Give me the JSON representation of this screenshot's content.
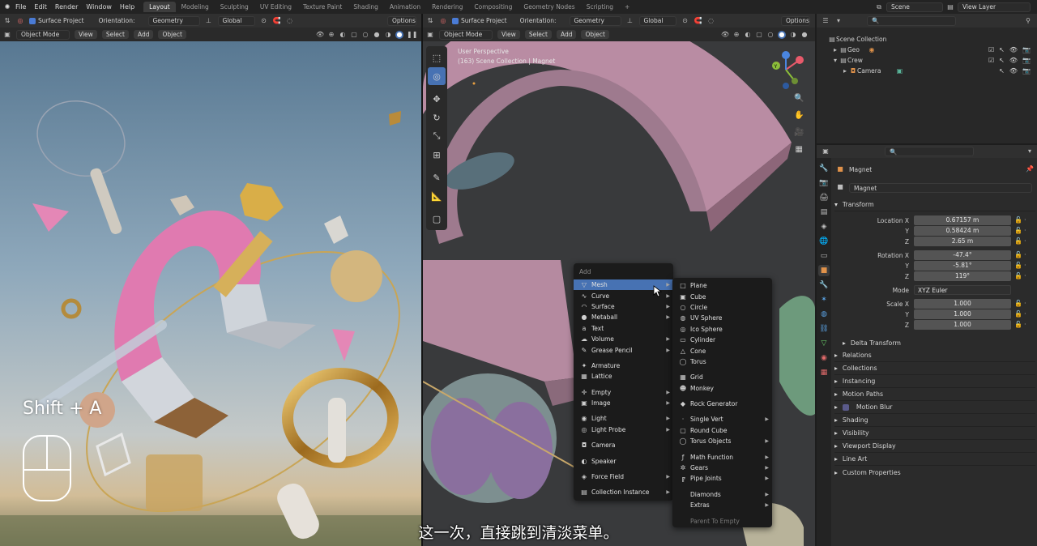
{
  "topbar": {
    "menus": [
      "File",
      "Edit",
      "Render",
      "Window",
      "Help"
    ],
    "workspaces": [
      "Layout",
      "Modeling",
      "Sculpting",
      "UV Editing",
      "Texture Paint",
      "Shading",
      "Animation",
      "Rendering",
      "Compositing",
      "Geometry Nodes",
      "Scripting"
    ],
    "active_workspace": "Layout",
    "plus": "+",
    "scene": "Scene",
    "view_layer": "View Layer"
  },
  "left_header": {
    "surface_project": "Surface Project",
    "orientation_label": "Orientation:",
    "orientation_value": "Geometry",
    "transform_space": "Global",
    "options": "Options",
    "mode": "Object Mode",
    "menus": [
      "View",
      "Select",
      "Add",
      "Object"
    ]
  },
  "right_header": {
    "surface_project": "Surface Project",
    "orientation_label": "Orientation:",
    "orientation_value": "Geometry",
    "transform_space": "Global",
    "options": "Options",
    "mode": "Object Mode",
    "menus": [
      "View",
      "Select",
      "Add",
      "Object"
    ]
  },
  "viewport_info": {
    "line1": "User Perspective",
    "line2": "(163) Scene Collection | Magnet"
  },
  "overlay": {
    "shortcut": "Shift + A"
  },
  "subtitle": "这一次，直接跳到清淡菜单。",
  "outliner": {
    "root": "Scene Collection",
    "items": [
      {
        "name": "Geo",
        "level": 1
      },
      {
        "name": "Crew",
        "level": 1
      },
      {
        "name": "Camera",
        "level": 2
      }
    ]
  },
  "properties": {
    "object_name": "Magnet",
    "data_name": "Magnet",
    "transform_title": "Transform",
    "location_label": "Location X",
    "location": [
      "0.67157 m",
      "0.58424 m",
      "2.65 m"
    ],
    "rotation_label": "Rotation X",
    "rotation": [
      "-47.4°",
      "-5.81°",
      "119°"
    ],
    "mode_label": "Mode",
    "mode_value": "XYZ Euler",
    "scale_label": "Scale X",
    "scale": [
      "1.000",
      "1.000",
      "1.000"
    ],
    "axis_y": "Y",
    "axis_z": "Z",
    "delta": "Delta Transform",
    "sections": [
      "Relations",
      "Collections",
      "Instancing",
      "Motion Paths",
      "Motion Blur",
      "Shading",
      "Visibility",
      "Viewport Display",
      "Line Art",
      "Custom Properties"
    ]
  },
  "add_menu": {
    "title": "Add",
    "items": [
      {
        "label": "Mesh",
        "icon": "▽",
        "sub": true
      },
      {
        "label": "Curve",
        "icon": "∿",
        "sub": true
      },
      {
        "label": "Surface",
        "icon": "◠",
        "sub": true
      },
      {
        "label": "Metaball",
        "icon": "●",
        "sub": true
      },
      {
        "label": "Text",
        "icon": "a",
        "sub": false
      },
      {
        "label": "Volume",
        "icon": "☁",
        "sub": true
      },
      {
        "label": "Grease Pencil",
        "icon": "✎",
        "sub": true
      },
      {
        "sep": true
      },
      {
        "label": "Armature",
        "icon": "✦",
        "sub": false
      },
      {
        "label": "Lattice",
        "icon": "▦",
        "sub": false
      },
      {
        "sep": true
      },
      {
        "label": "Empty",
        "icon": "✛",
        "sub": true
      },
      {
        "label": "Image",
        "icon": "▣",
        "sub": true
      },
      {
        "sep": true
      },
      {
        "label": "Light",
        "icon": "◉",
        "sub": true
      },
      {
        "label": "Light Probe",
        "icon": "◎",
        "sub": true
      },
      {
        "sep": true
      },
      {
        "label": "Camera",
        "icon": "◘",
        "sub": false
      },
      {
        "sep": true
      },
      {
        "label": "Speaker",
        "icon": "◐",
        "sub": false
      },
      {
        "sep": true
      },
      {
        "label": "Force Field",
        "icon": "◈",
        "sub": true
      },
      {
        "sep": true
      },
      {
        "label": "Collection Instance",
        "icon": "▤",
        "sub": true
      }
    ]
  },
  "mesh_menu": {
    "items": [
      {
        "label": "Plane",
        "icon": "□"
      },
      {
        "label": "Cube",
        "icon": "▣"
      },
      {
        "label": "Circle",
        "icon": "○"
      },
      {
        "label": "UV Sphere",
        "icon": "◍"
      },
      {
        "label": "Ico Sphere",
        "icon": "◎"
      },
      {
        "label": "Cylinder",
        "icon": "▭"
      },
      {
        "label": "Cone",
        "icon": "△"
      },
      {
        "label": "Torus",
        "icon": "◯"
      },
      {
        "sep": true
      },
      {
        "label": "Grid",
        "icon": "▦"
      },
      {
        "label": "Monkey",
        "icon": "☻"
      },
      {
        "sep": true
      },
      {
        "label": "Rock Generator",
        "icon": "◆"
      },
      {
        "sep": true
      },
      {
        "label": "Single Vert",
        "icon": "·",
        "sub": true
      },
      {
        "label": "Round Cube",
        "icon": "▢"
      },
      {
        "label": "Torus Objects",
        "icon": "◯",
        "sub": true
      },
      {
        "sep": true
      },
      {
        "label": "Math Function",
        "icon": "ƒ",
        "sub": true
      },
      {
        "label": "Gears",
        "icon": "✲",
        "sub": true
      },
      {
        "label": "Pipe Joints",
        "icon": "╔",
        "sub": true
      },
      {
        "sep": true
      },
      {
        "label": "Diamonds",
        "icon": "",
        "sub": true
      },
      {
        "label": "Extras",
        "icon": "",
        "sub": true
      },
      {
        "sep": true
      },
      {
        "label": "Parent To Empty",
        "icon": "",
        "dim": true
      }
    ]
  }
}
